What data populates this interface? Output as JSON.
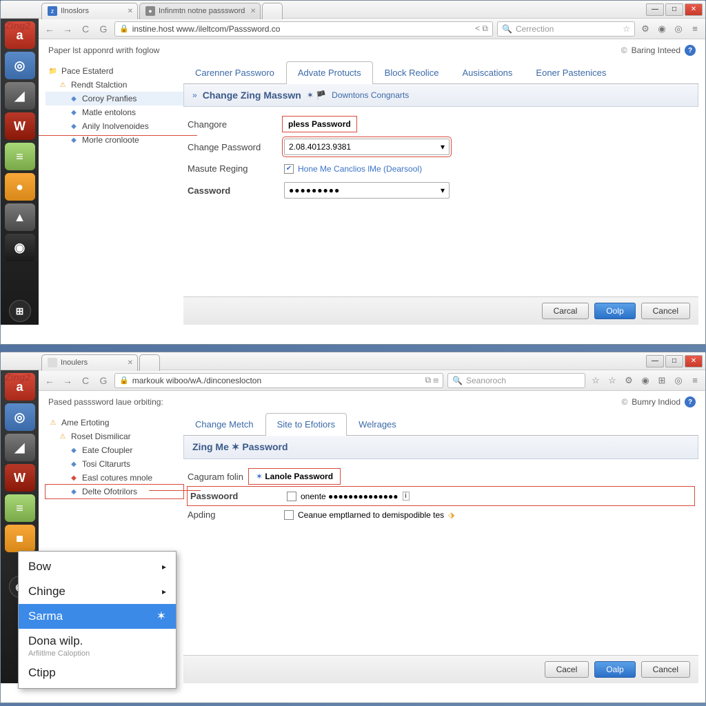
{
  "win1": {
    "controls": {
      "min": "—",
      "max": "□",
      "close": "✕"
    },
    "logo": "Zing2",
    "tabs": [
      {
        "label": "Ilnoslors",
        "favicon": "z"
      },
      {
        "label": "Infinmtn notne passsword",
        "favicon": "●"
      }
    ],
    "addr": {
      "url": "instine.host www./ileltcom/Passsword.co",
      "search_placeholder": "Cerrection",
      "star": "☆"
    },
    "header_left": "Paper lst apponrd writh foglow",
    "header_right": "Baring Inteed",
    "tree": [
      {
        "icon": "📁",
        "label": "Pace Estaterd",
        "cls": ""
      },
      {
        "icon": "⚠",
        "label": "Rendt Stalction",
        "cls": "l1"
      },
      {
        "icon": "◆",
        "label": "Coroy Pranfies",
        "cls": "l2 hl"
      },
      {
        "icon": "◆",
        "label": "Matle entolons",
        "cls": "l2"
      },
      {
        "icon": "◆",
        "label": "Anily Inolvenoides",
        "cls": "l2"
      },
      {
        "icon": "◆",
        "label": "Morle cronloote",
        "cls": "l2"
      }
    ],
    "maintabs": [
      "Carenner Passworo",
      "Advate Protucts",
      "Block Reolice",
      "Ausiscations",
      "Eoner Pastenices"
    ],
    "maintab_active": 1,
    "panel_title": "Change Zing Masswn",
    "panel_sub": "Downtons Congnarts",
    "form": {
      "row1_label": "Changore",
      "row1_value": "pless Password",
      "row2_label": "Change Password",
      "row2_value": "2.08.40123.9381",
      "row3_label": "Masute Reging",
      "row3_link": "Hone Me Canclios lMe (Dearsool)",
      "row4_label": "Cassword",
      "row4_value": "●●●●●●●●●"
    },
    "buttons": {
      "b1": "Carcal",
      "b2": "Oolp",
      "b3": "Cancel"
    }
  },
  "win2": {
    "controls": {
      "min": "—",
      "max": "□",
      "close": "✕"
    },
    "logo": "Zing2",
    "tabs": [
      {
        "label": "Inoulers",
        "favicon": ""
      }
    ],
    "addr": {
      "url": "markouk wiboo/wA./dinconeslocton",
      "search_placeholder": "Seanoroch"
    },
    "header_left": "Pased passsword laue orbiting:",
    "header_right": "Bumry Indiod",
    "tree": [
      {
        "icon": "⚠",
        "label": "Ame Ertoting",
        "cls": ""
      },
      {
        "icon": "⚠",
        "label": "Roset Dismilicar",
        "cls": "l1"
      },
      {
        "icon": "◆",
        "label": "Eate Cfoupler",
        "cls": "l2"
      },
      {
        "icon": "◆",
        "label": "Tosi Cltarurts",
        "cls": "l2"
      },
      {
        "icon": "◆",
        "label": "Easl cotures mnole",
        "cls": "l2"
      },
      {
        "icon": "◆",
        "label": "Delte Ofotrilors",
        "cls": "l2 hl"
      }
    ],
    "maintabs": [
      "Change Metch",
      "Site to Efotiors",
      "Welrages"
    ],
    "maintab_active": 1,
    "panel_title": "Zing Me ✶ Password",
    "form": {
      "row1a_label": "Caguram folin",
      "row1b_label": "Lanole Password",
      "row2_label": "Passwoord",
      "row2_value": "onente ●●●●●●●●●●●●●●",
      "row3_label": "Apding",
      "row3_text": "Ceanue emptlarned to demispodible tes"
    },
    "buttons": {
      "b1": "Cacel",
      "b2": "Oalp",
      "b3": "Cancel"
    },
    "context_menu": {
      "items": [
        {
          "label": "Bow",
          "arrow": "▸"
        },
        {
          "label": "Chinge",
          "arrow": "▸"
        },
        {
          "label": "Sarma",
          "arrow": "",
          "sel": true,
          "icon": "✶"
        },
        {
          "label": "Dona wilp.",
          "arrow": "",
          "sub": "Arfiitlme Caloption"
        },
        {
          "label": "Ctipp",
          "arrow": ""
        }
      ]
    }
  },
  "dock_icons": [
    "a",
    "◎",
    "◢",
    "W",
    "≡",
    "●",
    "▲",
    "◉"
  ],
  "dock2_icons": [
    "a",
    "◎",
    "◢",
    "W",
    "≡",
    "■",
    "◉"
  ]
}
